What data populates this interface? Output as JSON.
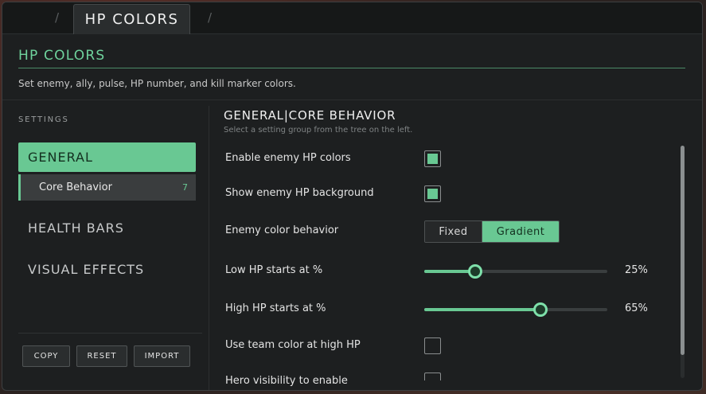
{
  "tabs": {
    "active_label": "HP COLORS"
  },
  "panel": {
    "title": "HP COLORS",
    "description": "Set enemy, ally, pulse, HP number, and kill marker colors."
  },
  "sidebar": {
    "section_label": "SETTINGS",
    "groups": [
      {
        "label": "GENERAL",
        "active": true,
        "children": [
          {
            "label": "Core Behavior",
            "count": "7"
          }
        ]
      },
      {
        "label": "HEALTH BARS"
      },
      {
        "label": "VISUAL EFFECTS"
      }
    ],
    "buttons": {
      "copy": "COPY",
      "reset": "RESET",
      "import": "IMPORT"
    }
  },
  "content": {
    "title": "GENERAL|CORE BEHAVIOR",
    "subtitle": "Select a setting group from the tree on the left.",
    "rows": [
      {
        "label": "Enable enemy HP colors",
        "type": "checkbox",
        "checked": true
      },
      {
        "label": "Show enemy HP background",
        "type": "checkbox",
        "checked": true
      },
      {
        "label": "Enemy color behavior",
        "type": "segmented",
        "options": [
          "Fixed",
          "Gradient"
        ],
        "selected": "Gradient"
      },
      {
        "label": "Low HP starts at %",
        "type": "slider",
        "value": 25,
        "display": "25%"
      },
      {
        "label": "High HP starts at %",
        "type": "slider",
        "value": 65,
        "display": "65%"
      },
      {
        "label": "Use team color at high HP",
        "type": "checkbox",
        "checked": false
      },
      {
        "label": "Hero visibility to enable",
        "type": "checkbox",
        "checked": false
      }
    ]
  },
  "colors": {
    "accent": "#69c893",
    "background": "#1d1f20"
  }
}
